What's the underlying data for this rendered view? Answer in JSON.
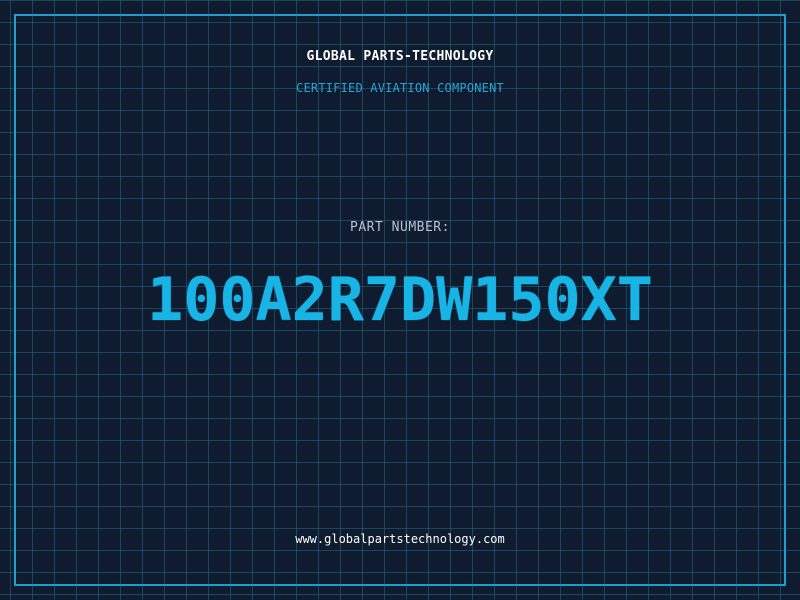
{
  "header": {
    "company": "GLOBAL PARTS-TECHNOLOGY",
    "tagline": "CERTIFIED AVIATION COMPONENT"
  },
  "part": {
    "label": "PART NUMBER:",
    "number": "100A2R7DW150XT"
  },
  "footer": {
    "website": "www.globalpartstechnology.com"
  },
  "colors": {
    "background": "#0f1b2f",
    "grid": "#23698a",
    "accent": "#18b4e6",
    "frame": "#1f9fcf"
  }
}
